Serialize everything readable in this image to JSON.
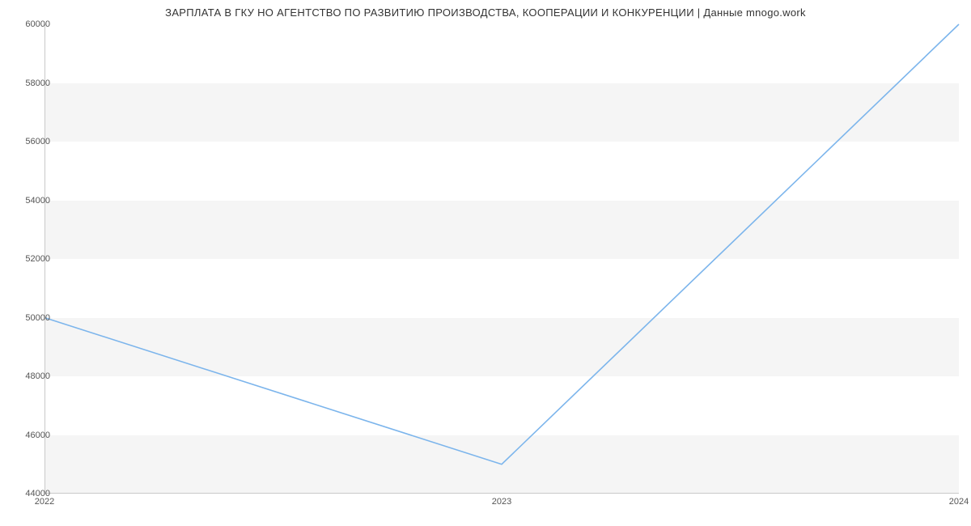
{
  "chart_data": {
    "type": "line",
    "title": "ЗАРПЛАТА В ГКУ НО АГЕНТСТВО ПО РАЗВИТИЮ ПРОИЗВОДСТВА, КООПЕРАЦИИ И КОНКУРЕНЦИИ | Данные mnogo.work",
    "x": [
      2022,
      2023,
      2024
    ],
    "values": [
      50000,
      45000,
      60000
    ],
    "ylim": [
      44000,
      60000
    ],
    "ytick_values": [
      44000,
      46000,
      48000,
      50000,
      52000,
      54000,
      56000,
      58000,
      60000
    ],
    "ytick_labels": [
      "44000",
      "46000",
      "48000",
      "50000",
      "52000",
      "54000",
      "56000",
      "58000",
      "60000"
    ],
    "xtick_labels": [
      "2022",
      "2023",
      "2024"
    ],
    "xlabel": "",
    "ylabel": "",
    "band_color": "#f5f5f5",
    "line_color": "#7cb5ec"
  }
}
